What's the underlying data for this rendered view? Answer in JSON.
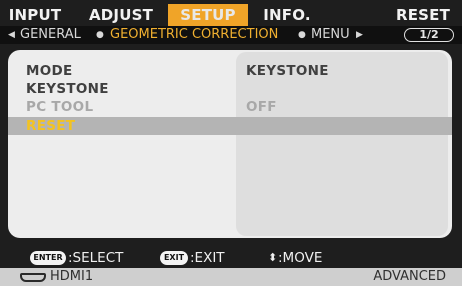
{
  "tabs": [
    {
      "label": "INPUT",
      "active": false
    },
    {
      "label": "ADJUST",
      "active": false
    },
    {
      "label": "SETUP",
      "active": true
    },
    {
      "label": "INFO.",
      "active": false
    },
    {
      "label": "RESET",
      "active": false
    }
  ],
  "breadcrumb": {
    "left_arrow": "◀",
    "prev": "GENERAL",
    "sep1": "●",
    "current": "GEOMETRIC CORRECTION",
    "sep2": "●",
    "next": "MENU",
    "right_arrow": "▶",
    "page": "1/2"
  },
  "menu": {
    "rows": [
      {
        "label": "MODE",
        "value": "KEYSTONE",
        "state": "normal"
      },
      {
        "label": "KEYSTONE",
        "value": "",
        "state": "normal"
      },
      {
        "label": "PC TOOL",
        "value": "OFF",
        "state": "disabled"
      },
      {
        "label": "RESET",
        "value": "",
        "state": "selected"
      }
    ]
  },
  "footer": {
    "enter_key": "ENTER",
    "enter_text": ":SELECT",
    "exit_key": "EXIT",
    "exit_text": ":EXIT",
    "move_symbol": "⬍",
    "move_text": ":MOVE"
  },
  "status": {
    "input_icon": "hdmi-icon",
    "input": "HDMI1",
    "mode": "ADVANCED"
  },
  "colors": {
    "accent": "#f0a428",
    "selected_text": "#f3c321",
    "background": "#1e1e1e",
    "panel": "#ededed"
  }
}
